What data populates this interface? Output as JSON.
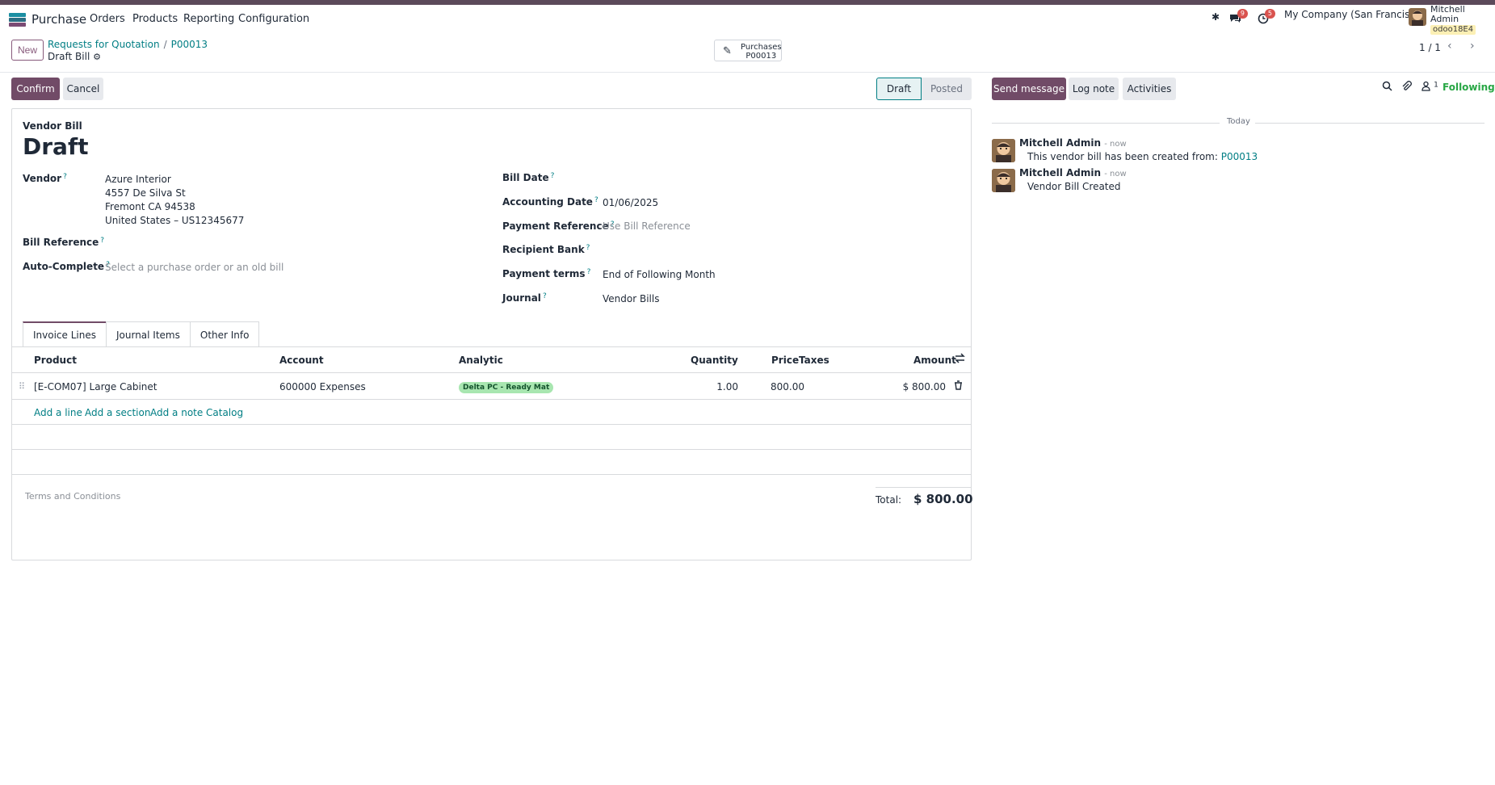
{
  "navbar": {
    "app_name": "Purchase",
    "menu": [
      "Orders",
      "Products",
      "Reporting",
      "Configuration"
    ],
    "messages_badge": "9",
    "activities_badge": "5",
    "company": "My Company (San Francisco)",
    "user_name": "Mitchell Admin",
    "db_name": "odoo18E4"
  },
  "control_panel": {
    "new_label": "New",
    "breadcrumb": [
      "Requests for Quotation",
      "P00013"
    ],
    "record_title": "Draft Bill",
    "smart_button": {
      "label": "Purchases",
      "value": "P00013"
    },
    "pager": "1 / 1"
  },
  "actions": {
    "confirm_label": "Confirm",
    "cancel_label": "Cancel",
    "status_steps": [
      "Draft",
      "Posted"
    ],
    "status_active": "Draft"
  },
  "form": {
    "doc_type": "Vendor Bill",
    "state_title": "Draft",
    "vendor_label": "Vendor",
    "vendor_lines": [
      "Azure Interior",
      "4557 De Silva St",
      "Fremont CA 94538",
      "United States – US12345677"
    ],
    "bill_reference_label": "Bill Reference",
    "auto_complete_label": "Auto-Complete",
    "auto_complete_placeholder": "Select a purchase order or an old bill",
    "bill_date_label": "Bill Date",
    "accounting_date_label": "Accounting Date",
    "accounting_date": "01/06/2025",
    "payment_reference_label": "Payment Reference",
    "payment_reference_placeholder": "Use Bill Reference",
    "recipient_bank_label": "Recipient Bank",
    "payment_terms_label": "Payment terms",
    "payment_terms": "End of Following Month",
    "journal_label": "Journal",
    "journal": "Vendor Bills",
    "help_mark": "?"
  },
  "tabs": [
    "Invoice Lines",
    "Journal Items",
    "Other Info"
  ],
  "lines": {
    "headers": {
      "product": "Product",
      "account": "Account",
      "analytic": "Analytic",
      "quantity": "Quantity",
      "price": "Price",
      "taxes": "Taxes",
      "amount": "Amount"
    },
    "rows": [
      {
        "product": "[E-COM07] Large Cabinet",
        "account": "600000 Expenses",
        "analytic": "Delta PC - Ready Mat",
        "quantity": "1.00",
        "price": "800.00",
        "taxes": "",
        "amount": "$ 800.00"
      }
    ],
    "add_links": [
      "Add a line",
      "Add a section",
      "Add a note",
      "Catalog"
    ]
  },
  "footer": {
    "terms_placeholder": "Terms and Conditions",
    "total_label": "Total:",
    "total_value": "$ 800.00"
  },
  "chatter": {
    "send_message": "Send message",
    "log_note": "Log note",
    "activities": "Activities",
    "followers_count": "1",
    "following": "Following",
    "date_separator": "Today",
    "messages": [
      {
        "author": "Mitchell Admin",
        "time": "- now",
        "body": "This vendor bill has been created from:",
        "link": "P00013"
      },
      {
        "author": "Mitchell Admin",
        "time": "- now",
        "body": "Vendor Bill Created",
        "link": ""
      }
    ]
  },
  "colors": {
    "brand": "#714b67",
    "link": "#017e84",
    "following": "#28a745",
    "badge": "#d9534f"
  }
}
